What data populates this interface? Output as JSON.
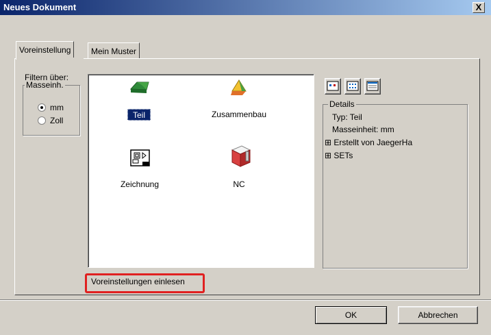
{
  "window": {
    "title": "Neues Dokument",
    "close_label": "X"
  },
  "tabs": [
    {
      "label": "Voreinstellung",
      "active": true
    },
    {
      "label": "Mein Muster",
      "active": false
    }
  ],
  "filter": {
    "label": "Filtern über:",
    "group_label": "Masseinh.",
    "options": [
      "mm",
      "Zoll"
    ],
    "selected": "mm"
  },
  "templates": [
    {
      "label": "Teil",
      "icon": "part-icon",
      "selected": true
    },
    {
      "label": "Zusammenbau",
      "icon": "assembly-icon",
      "selected": false
    },
    {
      "label": "Zeichnung",
      "icon": "drawing-icon",
      "selected": false
    },
    {
      "label": "NC",
      "icon": "nc-icon",
      "selected": false
    }
  ],
  "view_buttons": [
    "large-icons-view-icon",
    "small-icons-view-icon",
    "details-view-icon"
  ],
  "details": {
    "group_label": "Details",
    "lines": [
      "Typ: Teil",
      "Masseinheit: mm"
    ],
    "tree": [
      "Erstellt von JaegerHa",
      "SETs"
    ],
    "expander": "⊞"
  },
  "load_defaults_label": "Voreinstellungen einlesen",
  "highlight_color": "#e02020",
  "buttons": {
    "ok": "OK",
    "cancel": "Abbrechen"
  }
}
